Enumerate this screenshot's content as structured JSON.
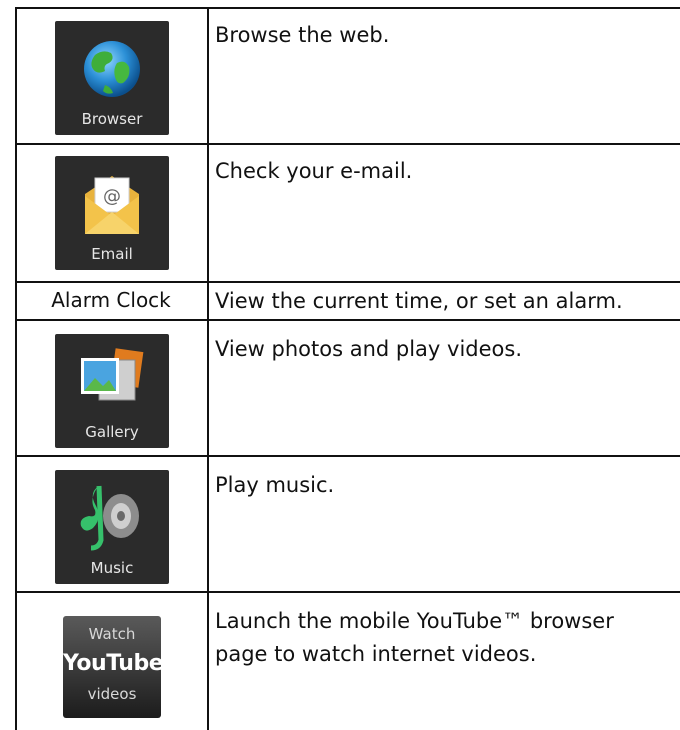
{
  "rows": [
    {
      "icon": "globe-icon",
      "label": "Browser",
      "description": "Browse the web."
    },
    {
      "icon": "email-envelope-icon",
      "label": "Email",
      "description": "Check your e-mail."
    },
    {
      "icon": null,
      "label": "Alarm Clock",
      "description": "View the current time, or set an alarm."
    },
    {
      "icon": "gallery-photos-icon",
      "label": "Gallery",
      "description": "View photos and play videos."
    },
    {
      "icon": "music-note-speaker-icon",
      "label": "Music",
      "description": "Play music."
    },
    {
      "icon": "youtube-badge-icon",
      "label": "",
      "description_line1": "Launch the mobile YouTube™ browser",
      "description_line2": "page to watch internet videos."
    }
  ],
  "youtube_badge": {
    "line1": "Watch",
    "line2": "YouTube",
    "line3": "videos"
  }
}
